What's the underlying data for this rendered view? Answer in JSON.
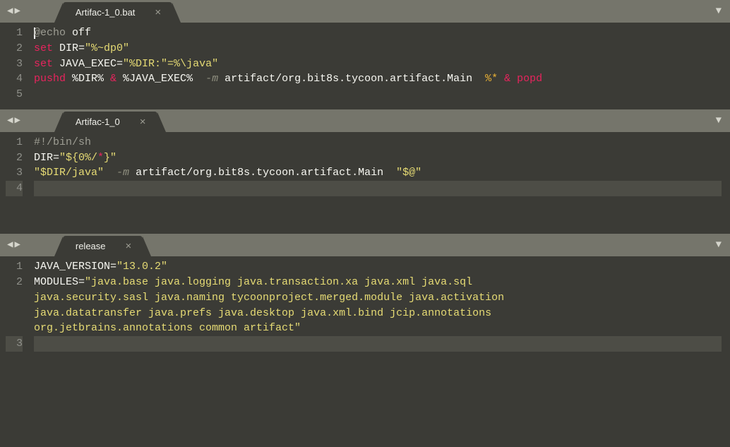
{
  "panes": [
    {
      "tab": {
        "title": "Artifac-1_0.bat"
      },
      "gutter": [
        "1",
        "2",
        "3",
        "4",
        "5"
      ],
      "lines": {
        "l1": {
          "a": "@echo",
          "b": " off"
        },
        "l2": {
          "a": "set",
          "b": " DIR=",
          "c": "\"%~dp0\""
        },
        "l3": {
          "a": "set",
          "b": " JAVA_EXEC=",
          "c": "\"%DIR:\"=%\\java\""
        },
        "l4": {
          "a": "pushd",
          "b": " %DIR% ",
          "c": "&",
          "d": " %JAVA_EXEC%  ",
          "e": "-m",
          "f": " artifact/org.bit8s.tycoon.artifact.Main  ",
          "g": "%*",
          "h": " & popd"
        }
      }
    },
    {
      "tab": {
        "title": "Artifac-1_0"
      },
      "gutter": [
        "1",
        "2",
        "3",
        "4"
      ],
      "lines": {
        "l1": {
          "a": "#!/bin/sh"
        },
        "l2": {
          "a": "DIR=",
          "b": "\"${0%/",
          "c": "*",
          "d": "}\""
        },
        "l3": {
          "a": "\"$DIR/java\"",
          "b": "  ",
          "c": "-m",
          "d": " artifact/org.bit8s.tycoon.artifact.Main  ",
          "e": "\"$@\""
        }
      }
    },
    {
      "tab": {
        "title": "release"
      },
      "gutter_pre": [
        "1",
        "2"
      ],
      "gutter_post": [
        "3"
      ],
      "lines": {
        "l1": {
          "a": "JAVA_VERSION=",
          "b": "\"13.0.2\""
        },
        "l2a": {
          "a": "MODULES=",
          "b": "\"java.base java.logging java.transaction.xa java.xml java.sql "
        },
        "l2b": {
          "a": "java.security.sasl java.naming tycoonproject.merged.module java.activation "
        },
        "l2c": {
          "a": "java.datatransfer java.prefs java.desktop java.xml.bind jcip.annotations "
        },
        "l2d": {
          "a": "org.jetbrains.annotations common artifact\""
        }
      }
    }
  ]
}
